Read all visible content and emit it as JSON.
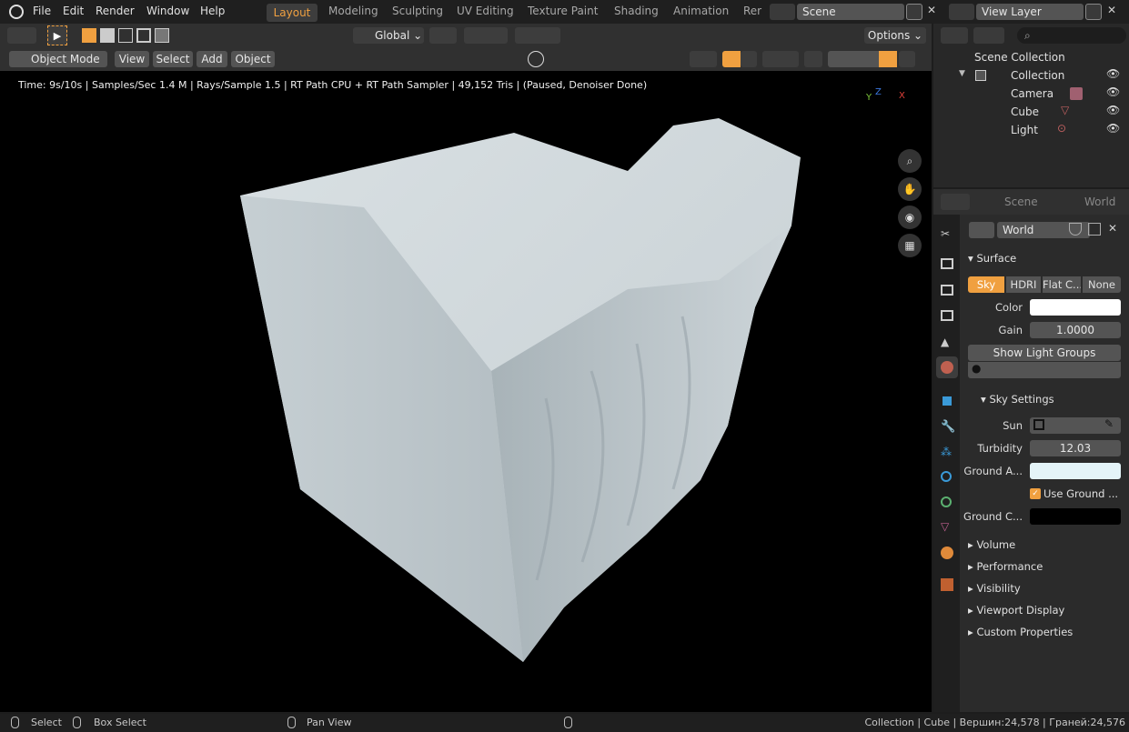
{
  "menu": {
    "file": "File",
    "edit": "Edit",
    "render": "Render",
    "window": "Window",
    "help": "Help"
  },
  "workspaces": [
    "Layout",
    "Modeling",
    "Sculpting",
    "UV Editing",
    "Texture Paint",
    "Shading",
    "Animation",
    "Rer"
  ],
  "scene_field": "Scene",
  "view_layer_field": "View Layer",
  "header": {
    "orientation": "Global",
    "options": "Options"
  },
  "header2": {
    "mode": "Object Mode",
    "view": "View",
    "select": "Select",
    "add": "Add",
    "object": "Object"
  },
  "render_info": "Time: 9s/10s | Samples/Sec 1.4 M | Rays/Sample 1.5 | RT Path CPU + RT Path Sampler | 49,152 Tris | (Paused, Denoiser Done)",
  "gizmo": {
    "x": "X",
    "y": "Y",
    "z": "Z"
  },
  "outliner": {
    "root": "Scene Collection",
    "collection": "Collection",
    "items": [
      "Camera",
      "Cube",
      "Light"
    ]
  },
  "props": {
    "breadcrumb_scene": "Scene",
    "breadcrumb_world": "World",
    "world_name": "World",
    "surface": "Surface",
    "tabs": [
      "Sky",
      "HDRI",
      "Flat C...",
      "None"
    ],
    "color_label": "Color",
    "gain_label": "Gain",
    "gain_value": "1.0000",
    "show_light_groups": "Show Light Groups",
    "sky_settings": "Sky Settings",
    "sun_label": "Sun",
    "turbidity_label": "Turbidity",
    "turbidity_value": "12.03",
    "ground_albedo_label": "Ground A...",
    "use_ground_label": "Use Ground ...",
    "ground_color_label": "Ground C...",
    "panels": [
      "Volume",
      "Performance",
      "Visibility",
      "Viewport Display",
      "Custom Properties"
    ],
    "color_value": "#ffffff",
    "ground_albedo_value": "#e4f4f8",
    "ground_color_value": "#000000"
  },
  "status": {
    "select": "Select",
    "box_select": "Box Select",
    "pan_view": "Pan View",
    "info": "Collection | Cube | Вершин:24,578 | Граней:24,576"
  },
  "accent": "#f0a040"
}
